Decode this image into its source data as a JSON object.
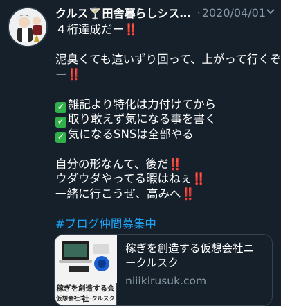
{
  "tweet": {
    "author_name": "クルス🍸田舎暮らしシステムエンジニア",
    "separator": "·",
    "date": "2020/04/01",
    "lines": [
      {
        "text": "４桁達成だー",
        "bang": "‼️"
      },
      {
        "text": "",
        "bang": ""
      },
      {
        "text": "泥臭くても這いずり回って、上がって行くぞ",
        "bang": ""
      },
      {
        "text": "ー",
        "bang": "‼️"
      },
      {
        "text": "",
        "bang": ""
      },
      {
        "text": "雑記より特化は力付けてから",
        "bang": "",
        "check": true
      },
      {
        "text": "取り敢えず気になる事を書く",
        "bang": "",
        "check": true
      },
      {
        "text": "気になるSNSは全部やる",
        "bang": "",
        "check": true
      },
      {
        "text": "",
        "bang": ""
      },
      {
        "text": "自分の形なんて、後だ",
        "bang": "‼️"
      },
      {
        "text": "ウダウダやってる暇はねぇ",
        "bang": "‼️"
      },
      {
        "text": "一緒に行こうぜ、高みへ",
        "bang": "‼️"
      },
      {
        "text": "",
        "bang": ""
      }
    ],
    "hashtag": "#ブログ仲間募集中",
    "check_glyph": "✓"
  },
  "card": {
    "title_line1": "稼ぎを創造する仮想会社ニ",
    "title_line2": "ークルスク",
    "domain": "niiikirusuk.com",
    "thumb_caption1": "稼ぎを創造する会社",
    "thumb_caption2": "仮想会社ニークルスク"
  },
  "icons": {
    "more": "chevron-down-icon",
    "check": "check-mark-icon"
  },
  "colors": {
    "background": "#15202b",
    "text": "#ffffff",
    "muted": "#8899a6",
    "link": "#1da1f2",
    "bang": "#e0245e",
    "check": "#31b14a"
  }
}
